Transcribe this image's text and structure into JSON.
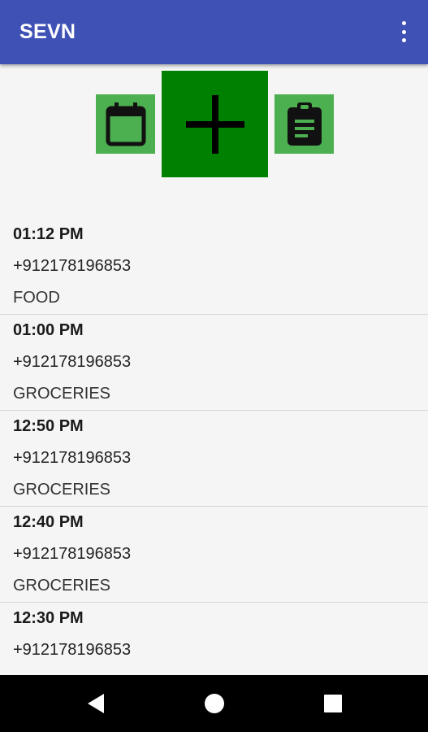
{
  "app_bar": {
    "title": "SEVN",
    "menu_icon": "more-vert-icon"
  },
  "actions": {
    "calendar_icon": "calendar-icon",
    "add_icon": "plus-icon",
    "report_icon": "clipboard-icon",
    "colors": {
      "small_button": "#4caf50",
      "add_button": "#008000"
    }
  },
  "entries": [
    {
      "time": "01:12 PM",
      "phone": "+912178196853",
      "category": "FOOD"
    },
    {
      "time": "01:00 PM",
      "phone": "+912178196853",
      "category": "GROCERIES"
    },
    {
      "time": "12:50 PM",
      "phone": "+912178196853",
      "category": "GROCERIES"
    },
    {
      "time": "12:40 PM",
      "phone": "+912178196853",
      "category": "GROCERIES"
    },
    {
      "time": "12:30 PM",
      "phone": "+912178196853",
      "category": ""
    }
  ],
  "nav_bar": {
    "back_icon": "back-triangle-icon",
    "home_icon": "home-circle-icon",
    "recents_icon": "recents-square-icon"
  },
  "theme": {
    "primary": "#3f51b5",
    "background": "#f5f5f5"
  }
}
